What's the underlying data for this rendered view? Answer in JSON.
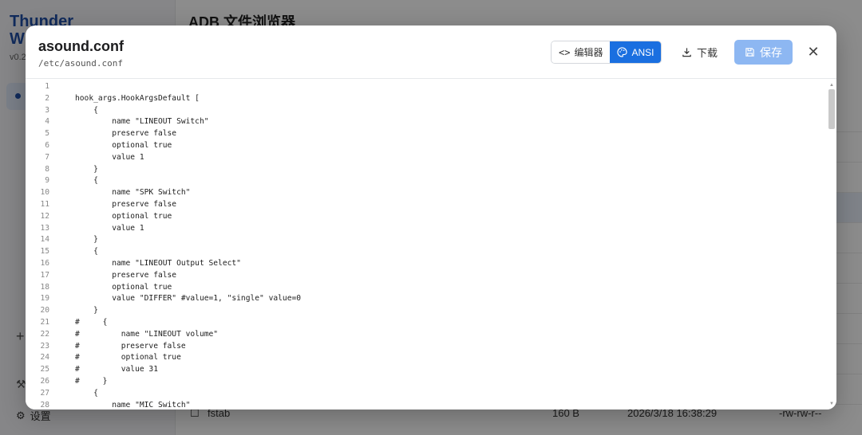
{
  "background": {
    "brand_line1": "Thunder",
    "brand_line2": "W",
    "version": "v0.2",
    "page_title": "ADB 文件浏览器",
    "settings_label": "设置",
    "bottom_row": {
      "name": "fstab",
      "size": "160 B",
      "date": "2026/3/18 16:38:29",
      "perms": "-rw-rw-r--"
    }
  },
  "modal": {
    "title": "asound.conf",
    "path": "/etc/asound.conf",
    "toolbar": {
      "editor_icon": "<>",
      "editor_label": "编辑器",
      "ansi_label": "ANSI",
      "download_label": "下载",
      "save_label": "保存",
      "close_label": "✕"
    }
  },
  "colors": {
    "accent": "#1a6fe0",
    "save_disabled": "#8db7f2"
  },
  "code": {
    "line_numbers": [
      "1",
      "2",
      "3",
      "4",
      "5",
      "6",
      "7",
      "8",
      "9",
      "10",
      "11",
      "12",
      "13",
      "14",
      "15",
      "16",
      "17",
      "18",
      "19",
      "20",
      "21",
      "22",
      "23",
      "24",
      "25",
      "26",
      "27",
      "28"
    ],
    "lines": [
      "",
      "hook_args.HookArgsDefault [",
      "    {",
      "        name \"LINEOUT Switch\"",
      "        preserve false",
      "        optional true",
      "        value 1",
      "    }",
      "    {",
      "        name \"SPK Switch\"",
      "        preserve false",
      "        optional true",
      "        value 1",
      "    }",
      "    {",
      "        name \"LINEOUT Output Select\"",
      "        preserve false",
      "        optional true",
      "        value \"DIFFER\" #value=1, \"single\" value=0",
      "    }",
      "#     {",
      "#         name \"LINEOUT volume\"",
      "#         preserve false",
      "#         optional true",
      "#         value 31",
      "#     }",
      "    {",
      "        name \"MIC Switch\""
    ]
  }
}
